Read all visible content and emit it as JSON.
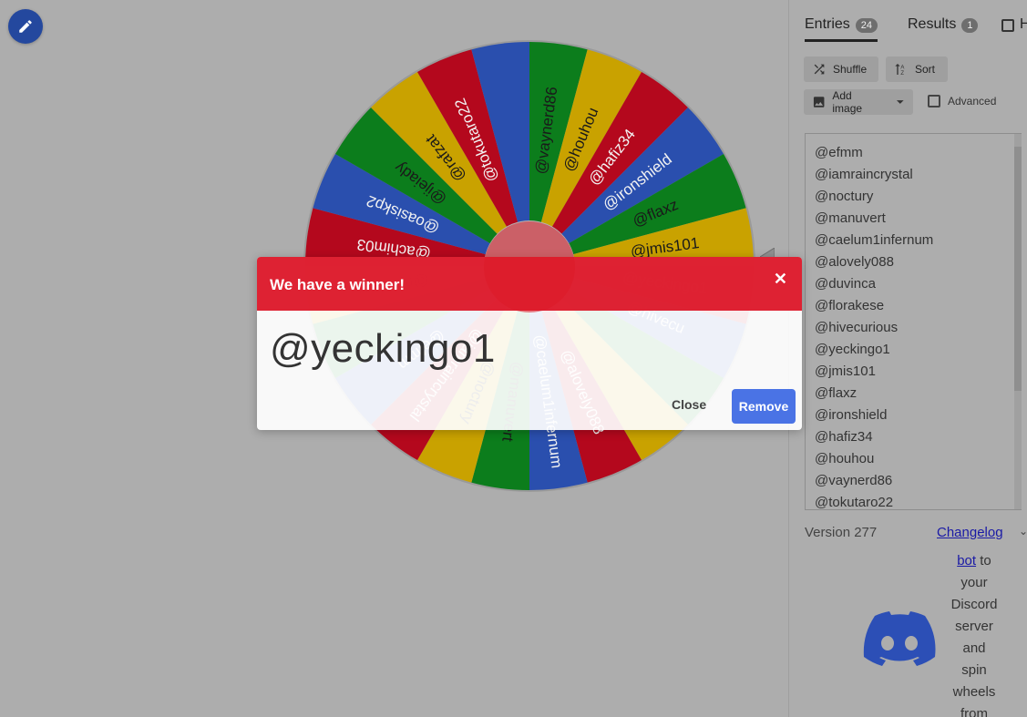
{
  "tabs": {
    "entries_label": "Entries",
    "entries_count": "24",
    "results_label": "Results",
    "results_count": "1",
    "hide_label": "H"
  },
  "toolbar": {
    "shuffle_label": "Shuffle",
    "sort_label": "Sort",
    "add_image_label": "Add image",
    "advanced_label": "Advanced"
  },
  "entries": [
    "@efmm",
    "@iamraincrystal",
    "@noctury",
    "@manuvert",
    "@caelum1infernum",
    "@alovely088",
    "@duvinca",
    "@florakese",
    "@hivecurious",
    "@yeckingo1",
    "@jmis101",
    "@flaxz",
    "@ironshield",
    "@hafiz34",
    "@houhou",
    "@vaynerd86",
    "@tokutaro22"
  ],
  "wheel": {
    "visible_labels": [
      "@vaynerd86",
      "@houhou",
      "@hafiz34",
      "@ironshield",
      "@flaxz",
      "@jmis101",
      "@yeckingo1",
      "@hivecu",
      "",
      "",
      "@alovely088",
      "@caelum1infernum",
      "@manuvert",
      "@noctury",
      "@iamraincrystal",
      "@efmm",
      "",
      "@monkey",
      "@achim03",
      "@oasiskp2",
      "@ijeiady",
      "@rafzat",
      "@tokutaro22",
      ""
    ],
    "colors": [
      "#0c7d1c",
      "#c9a200",
      "#b4081d",
      "#2a4fae"
    ]
  },
  "footer": {
    "version": "Version 277",
    "changelog": "Changelog",
    "discord_link": "bot",
    "discord_text_lines": [
      "to",
      "your",
      "Discord",
      "server",
      "and",
      "spin",
      "wheels",
      "from"
    ]
  },
  "dialog": {
    "title": "We have a winner!",
    "winner": "@yeckingo1",
    "close_label": "Close",
    "remove_label": "Remove"
  }
}
